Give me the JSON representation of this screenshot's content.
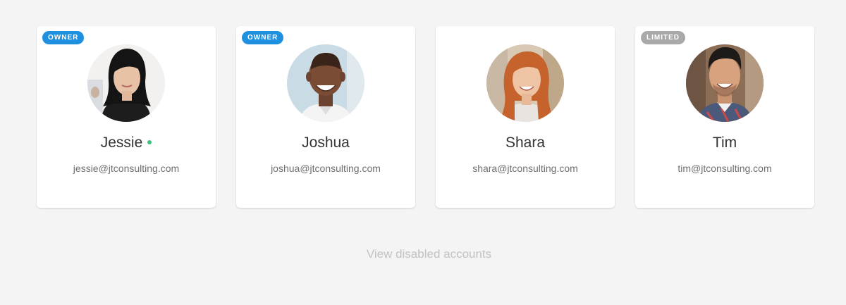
{
  "users": [
    {
      "badge": "OWNER",
      "badge_color": "#1f8fdf",
      "name": "Jessie",
      "online": true,
      "online_color": "#3cc47c",
      "email": "jessie@jtconsulting.com"
    },
    {
      "badge": "OWNER",
      "badge_color": "#1f8fdf",
      "name": "Joshua",
      "online": false,
      "email": "joshua@jtconsulting.com"
    },
    {
      "badge": "",
      "name": "Shara",
      "online": false,
      "email": "shara@jtconsulting.com"
    },
    {
      "badge": "LIMITED",
      "badge_color": "#a9a9a9",
      "name": "Tim",
      "online": false,
      "email": "tim@jtconsulting.com"
    }
  ],
  "footer": {
    "view_disabled_label": "View disabled accounts"
  }
}
